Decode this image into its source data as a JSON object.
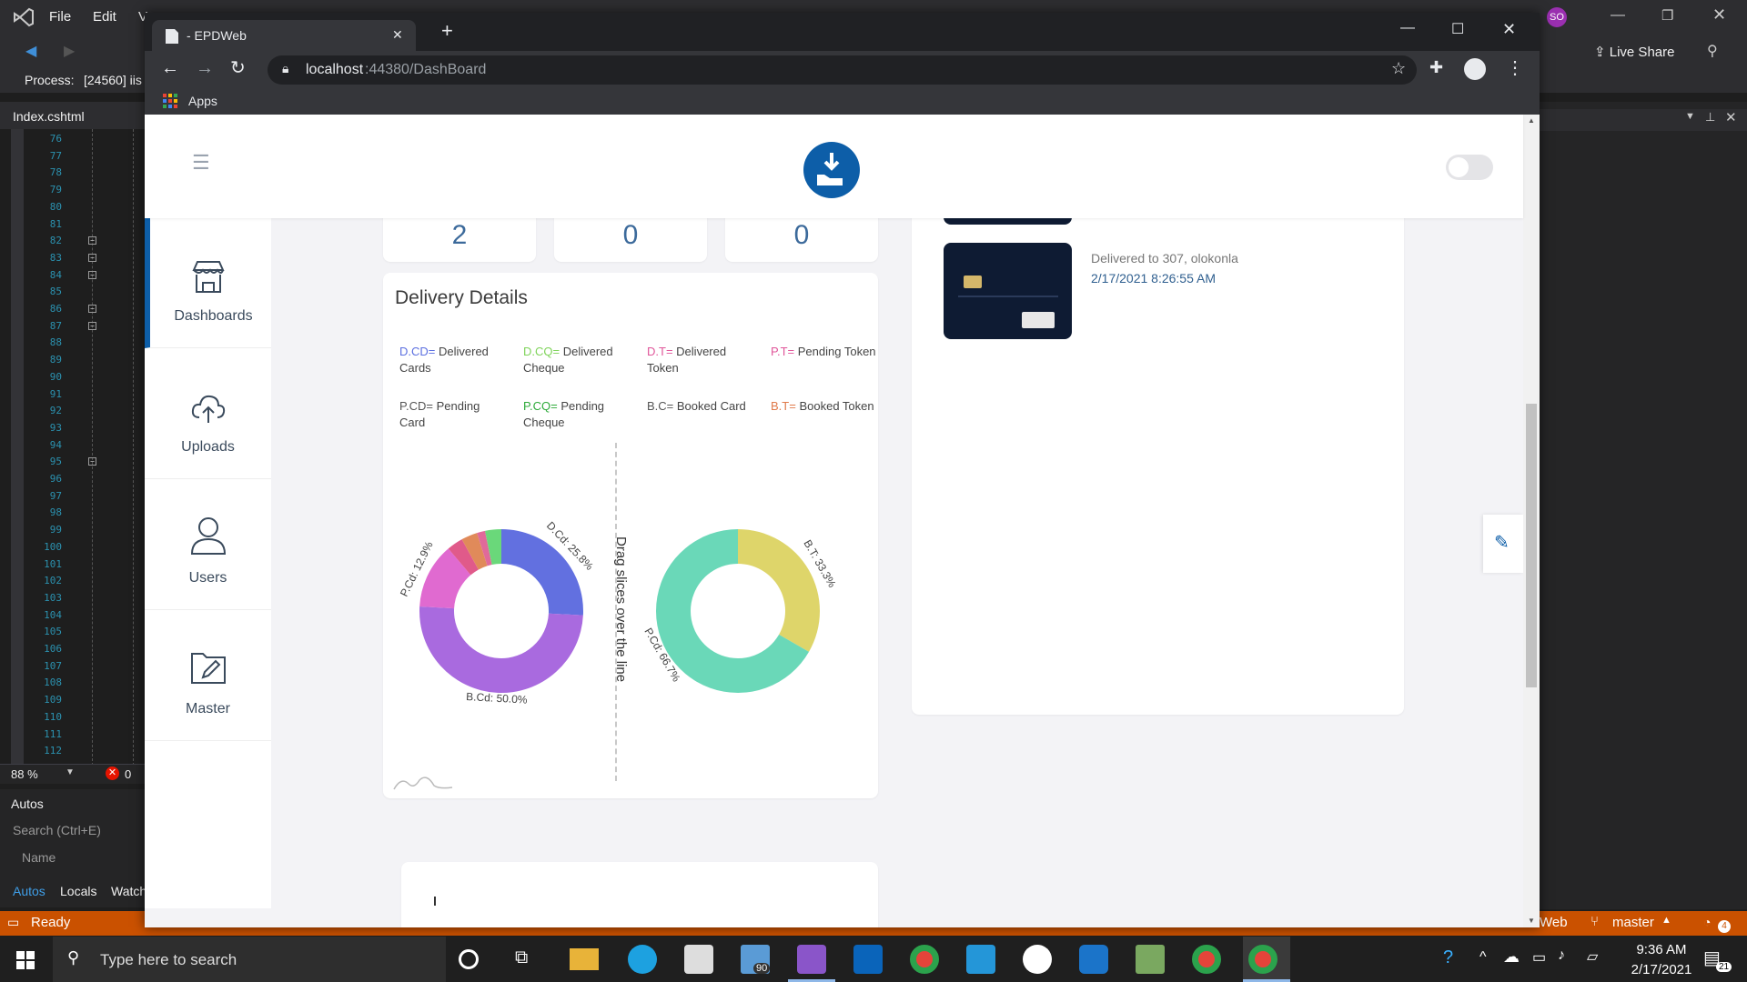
{
  "vs": {
    "menu": [
      "File",
      "Edit",
      "V"
    ],
    "process_label": "Process:",
    "process_value": "[24560] iis",
    "editor_tab": "Index.cshtml",
    "line_numbers": [
      "76",
      "77",
      "78",
      "79",
      "80",
      "81",
      "82",
      "83",
      "84",
      "85",
      "86",
      "87",
      "88",
      "89",
      "90",
      "91",
      "92",
      "93",
      "94",
      "95",
      "96",
      "97",
      "98",
      "99",
      "100",
      "101",
      "102",
      "103",
      "104",
      "105",
      "106",
      "107",
      "108",
      "109",
      "110",
      "111",
      "112"
    ],
    "zoom": "88 %",
    "error_count": "0",
    "autos_title": "Autos",
    "autos_search": "Search (Ctrl+E)",
    "autos_name_col": "Name",
    "autos_tabs": [
      "Autos",
      "Locals",
      "Watch"
    ],
    "status": "Ready",
    "user_initials": "SO",
    "live_share": "Live Share",
    "branch_repo": "Web",
    "branch": "master",
    "notif_count": "4"
  },
  "chrome": {
    "tab_title": "- EPDWeb",
    "url_host": "localhost",
    "url_rest": ":44380/DashBoard",
    "bookmark_apps": "Apps"
  },
  "page": {
    "sidebar": [
      {
        "label": "Dashboards",
        "icon": "store-icon",
        "active": true
      },
      {
        "label": "Uploads",
        "icon": "cloud-upload-icon",
        "active": false
      },
      {
        "label": "Users",
        "icon": "user-icon",
        "active": false
      },
      {
        "label": "Master",
        "icon": "folder-edit-icon",
        "active": false
      }
    ],
    "stats": [
      "2",
      "0",
      "0"
    ],
    "delivery": {
      "title": "Delivery Details",
      "legend": [
        {
          "code": "D.CD=",
          "text": "Delivered Cards",
          "color": "#5b6fe0"
        },
        {
          "code": "D.CQ=",
          "text": "Delivered Cheque",
          "color": "#7fd45a"
        },
        {
          "code": "D.T=",
          "text": "Delivered Token",
          "color": "#e0569a"
        },
        {
          "code": "P.T=",
          "text": "Pending Token",
          "color": "#e0569a"
        },
        {
          "code": "P.CD=",
          "text": "Pending Card",
          "color": "#555555"
        },
        {
          "code": "P.CQ=",
          "text": "Pending Cheque",
          "color": "#2eaa3a"
        },
        {
          "code": "B.C=",
          "text": "Booked Card",
          "color": "#555555"
        },
        {
          "code": "B.T=",
          "text": "Booked Token",
          "color": "#e07a4a"
        }
      ],
      "divider_text": "Drag slices over the line"
    },
    "activity": [
      {
        "text": "Delivered to 307, olokonla",
        "time": "2/17/2021 8:26:55 AM"
      }
    ]
  },
  "chart_data": [
    {
      "type": "pie",
      "title": "",
      "labels": [
        "D.Cd",
        "B.Cd",
        "P.Cd",
        "P.T",
        "B.T",
        "D.T",
        "D.CQ"
      ],
      "values": [
        25.8,
        50.0,
        12.9,
        3.2,
        3.2,
        1.6,
        3.2
      ],
      "colors": [
        "#6270e0",
        "#a96adf",
        "#e06ad0",
        "#e05a8a",
        "#e08a5a",
        "#e06a9a",
        "#6ad87a"
      ],
      "visible_labels": [
        "D.Cd: 25.8%",
        "B.Cd: 50.0%",
        "P.Cd: 12.9%"
      ]
    },
    {
      "type": "pie",
      "title": "",
      "labels": [
        "B.T",
        "P.Cd"
      ],
      "values": [
        33.3,
        66.7
      ],
      "colors": [
        "#ded56a",
        "#6ad8b8"
      ],
      "visible_labels": [
        "B.T: 33.3%",
        "P.Cd: 66.7%"
      ]
    }
  ],
  "taskbar": {
    "search_placeholder": "Type here to search",
    "mail_badge": "90",
    "time": "9:36 AM",
    "date": "2/17/2021",
    "notif_badge": "21"
  }
}
